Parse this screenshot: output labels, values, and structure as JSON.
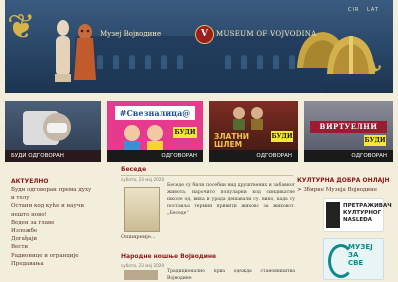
{
  "header": {
    "title_left": "Музеј Војводине",
    "title_right": "MUSEUM OF VOJVODINA",
    "logo_letter": "V",
    "languages": [
      "CIR",
      "LAT"
    ]
  },
  "banners": [
    {
      "label": "БУДИ ОДГОВОРАН",
      "title": ""
    },
    {
      "label": "ОДГОВОРАН",
      "title": "#Свезналица@",
      "badge": "БУДИ"
    },
    {
      "label": "ОДГОВОРАН",
      "title": "ЗЛАТНИ ШЛЕМ",
      "badge": "БУДИ"
    },
    {
      "label": "ОДГОВОРАН",
      "title": "ВИРТУЕЛНИ",
      "badge": "БУДИ"
    }
  ],
  "sidebar": {
    "title": "АКТУЕЛНО",
    "items": [
      "Буди одговоран према духу и телу",
      "Остани код куће и научи нешто ново!",
      "Веден за главе",
      "Изложбе",
      "Догађаји",
      "Вести",
      "Радионице и огранције",
      "Предавања"
    ]
  },
  "news": [
    {
      "title": "Беседе",
      "date": "субота, 23 мај 2020",
      "text": "Беседе су били посебни вид друштвених и забавног живота, нарочито популарни код синдикатне школе од, вика и урада дешавали су. вико, када су поставља термин привити жиховс за жиховот. „Беседе“"
    },
    {
      "title": "Народне ношње Војводине",
      "date": "субота, 23 мај 2020",
      "text": "Традиционално прва одежда становништва Војводине"
    }
  ],
  "more_label": "Опширније...",
  "right": {
    "title": "КУЛТУРНА ДОБРА ОНЛАЈН",
    "link": "> Збирке Музеја Војводине",
    "cards": [
      {
        "lines": [
          "ПРЕТРАЖИВАЧ",
          "КУЛТУРНОГ",
          "NASLEĐA"
        ]
      },
      {
        "lines": [
          "МУЗЕЈ",
          "ЗА",
          "СВЕ"
        ]
      }
    ]
  },
  "colors": {
    "header_bg": "#2f4c6e",
    "accent_red": "#8b1a1a",
    "gold": "#d8b24a",
    "page_bg": "#f3eedb"
  }
}
